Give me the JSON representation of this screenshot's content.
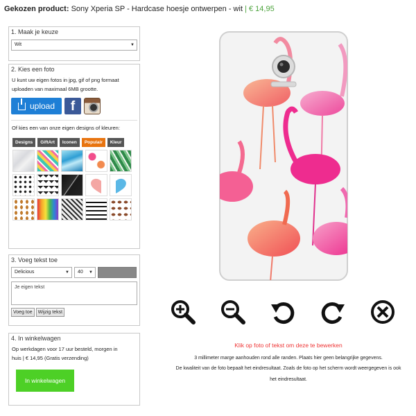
{
  "header": {
    "label": "Gekozen product:",
    "product": "Sony Xperia SP - Hardcase hoesje ontwerpen - wit",
    "separator": "|",
    "price": "€ 14,95"
  },
  "step1": {
    "title": "1. Maak je keuze",
    "select_value": "Wit"
  },
  "step2": {
    "title": "2. Kies een foto",
    "info_line1": "U kunt uw eigen fotos in jpg, gif of png formaat",
    "info_line2": "uploaden van maximaal 6MB grootte.",
    "upload_label": "upload",
    "facebook_glyph": "f",
    "designs_intro": "Of kies een van onze eigen designs of kleuren:",
    "tabs": [
      {
        "label": "Designs",
        "active": false
      },
      {
        "label": "GiftArt",
        "active": false
      },
      {
        "label": "Iconen",
        "active": false
      },
      {
        "label": "Populair",
        "active": true
      },
      {
        "label": "Kleur",
        "active": false
      }
    ],
    "swatch_names": [
      "marble-design",
      "pineapples-design",
      "blue-crystal-design",
      "flamingo-design",
      "palm-leaves-design",
      "dots-design",
      "chevron-design",
      "black-marble-design",
      "half-heart-pink-design",
      "half-heart-blue-design",
      "pineapple-pattern-design",
      "paint-drips-design",
      "herringbone-design",
      "black-stripes-design",
      "coffee-beans-design"
    ],
    "accent_color": "#e8740f"
  },
  "step3": {
    "title": "3. Voeg tekst toe",
    "font_value": "Delicious",
    "size_value": "40",
    "text_placeholder": "Je eigen tekst",
    "add_button": "Voeg toe",
    "edit_button": "Wijzig tekst"
  },
  "step4": {
    "title": "4. In winkelwagen",
    "info_line1": "Op werkdagen voor 17 uur besteld, morgen in",
    "info_line2": "huis | € 14,95 (Gratis verzending)",
    "cart_button": "In winkelwagen",
    "cart_color": "#4dd026"
  },
  "tools": [
    "zoom-in-icon",
    "zoom-out-icon",
    "rotate-left-icon",
    "rotate-right-icon",
    "close-icon"
  ],
  "notes": {
    "red": "Klik op foto of tekst om deze te bewerken",
    "line1": "3 millimeter marge aanhouden rond alle randen. Plaats hier geen belangrijke gegevens.",
    "line2": "De kwaliteit van de foto bepaalt het eindresultaat. Zoals de foto op het scherm wordt weergegeven is ook",
    "line3": "het eindresultaat."
  }
}
